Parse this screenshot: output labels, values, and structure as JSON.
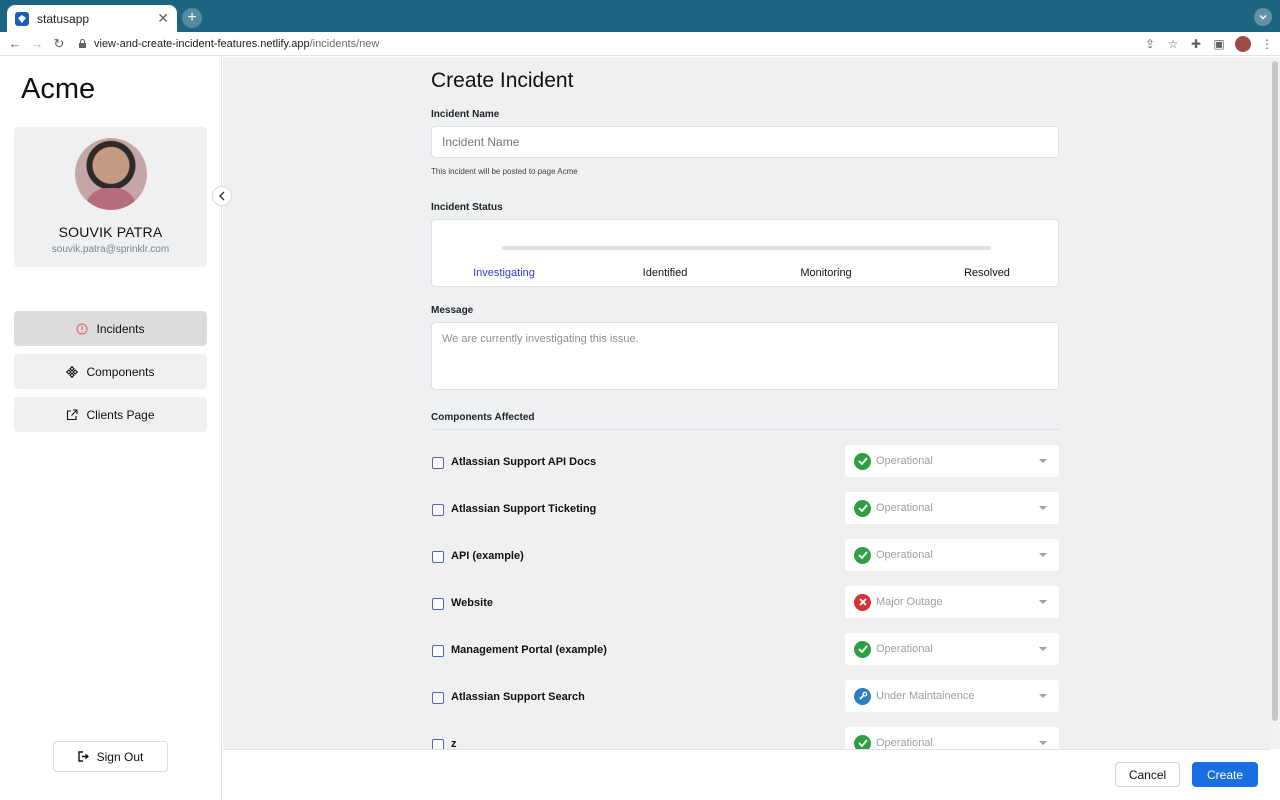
{
  "browser": {
    "tab_title": "statusapp",
    "url_host": "view-and-create-incident-features.netlify.app",
    "url_path": "/incidents/new"
  },
  "sidebar": {
    "brand": "Acme",
    "user_name": "SOUVIK PATRA",
    "user_email": "souvik.patra@sprinklr.com",
    "items": [
      {
        "label": "Incidents",
        "icon": "info-circle-icon",
        "active": true
      },
      {
        "label": "Components",
        "icon": "components-icon",
        "active": false
      },
      {
        "label": "Clients Page",
        "icon": "external-link-icon",
        "active": false
      }
    ],
    "sign_out": "Sign Out"
  },
  "form": {
    "title": "Create Incident",
    "name_label": "Incident Name",
    "name_placeholder": "Incident Name",
    "name_hint": "This incident will be posted to page Acme",
    "status_label": "Incident Status",
    "statuses": [
      "Investigating",
      "Identified",
      "Monitoring",
      "Resolved"
    ],
    "active_status": "Investigating",
    "message_label": "Message",
    "message_placeholder": "We are currently investigating this issue.",
    "components_label": "Components Affected",
    "components": [
      {
        "name": "Atlassian Support API Docs",
        "status": "Operational",
        "status_icon": "check-circle-icon",
        "color": "#2ea043"
      },
      {
        "name": "Atlassian Support Ticketing",
        "status": "Operational",
        "status_icon": "check-circle-icon",
        "color": "#2ea043"
      },
      {
        "name": "API (example)",
        "status": "Operational",
        "status_icon": "check-circle-icon",
        "color": "#2ea043"
      },
      {
        "name": "Website",
        "status": "Major Outage",
        "status_icon": "x-circle-icon",
        "color": "#d13438"
      },
      {
        "name": "Management Portal (example)",
        "status": "Operational",
        "status_icon": "check-circle-icon",
        "color": "#2ea043"
      },
      {
        "name": "Atlassian Support Search",
        "status": "Under Maintainence",
        "status_icon": "wrench-icon",
        "color": "#2f7cc0"
      },
      {
        "name": "z",
        "status": "Operational",
        "status_icon": "check-circle-icon",
        "color": "#2ea043"
      }
    ]
  },
  "footer": {
    "cancel": "Cancel",
    "create": "Create"
  }
}
